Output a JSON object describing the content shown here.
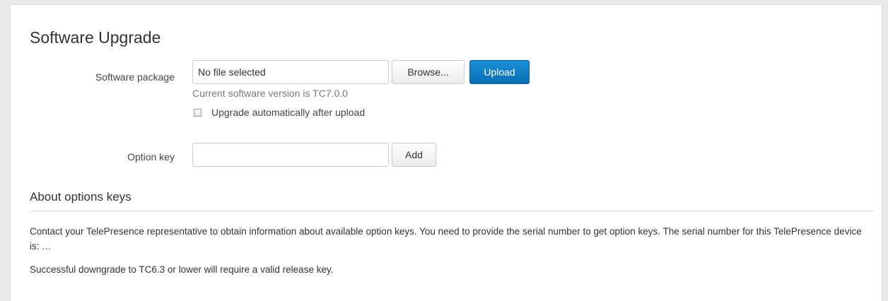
{
  "title": "Software Upgrade",
  "software_package": {
    "label": "Software package",
    "file_value": "No file selected",
    "browse_label": "Browse...",
    "upload_label": "Upload",
    "version_note": "Current software version is TC7.0.0",
    "auto_upgrade_label": "Upgrade automatically after upload",
    "auto_upgrade_checked": false
  },
  "option_key": {
    "label": "Option key",
    "value": "",
    "add_label": "Add"
  },
  "about": {
    "heading": "About options keys",
    "paragraph1": "Contact your TelePresence representative to obtain information about available option keys. You need to provide the serial number to get option keys. The serial number for this TelePresence device is: …",
    "paragraph2": "Successful downgrade to TC6.3 or lower will require a valid release key."
  },
  "colors": {
    "primary_button": "#0a6fb5",
    "page_background": "#e9e9e9",
    "panel_background": "#ffffff"
  }
}
